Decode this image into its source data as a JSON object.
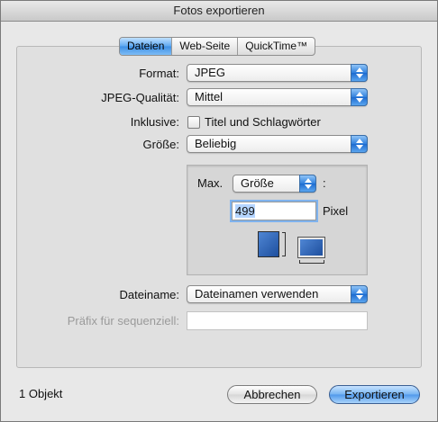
{
  "window": {
    "title": "Fotos exportieren"
  },
  "tabs": [
    {
      "label": "Dateien",
      "active": true
    },
    {
      "label": "Web-Seite",
      "active": false
    },
    {
      "label": "QuickTime™",
      "active": false
    }
  ],
  "form": {
    "format": {
      "label": "Format:",
      "value": "JPEG"
    },
    "quality": {
      "label": "JPEG-Qualität:",
      "value": "Mittel"
    },
    "include": {
      "label": "Inklusive:",
      "checkbox_label": "Titel und Schlagwörter",
      "checked": false
    },
    "size": {
      "label": "Größe:",
      "value": "Beliebig"
    },
    "max": {
      "label": "Max.",
      "dimension": "Größe",
      "colon": ":",
      "value": "499",
      "unit": "Pixel"
    },
    "filename": {
      "label": "Dateiname:",
      "value": "Dateinamen verwenden"
    },
    "prefix": {
      "label": "Präfix für sequenziell:",
      "value": ""
    }
  },
  "footer": {
    "count": "1 Objekt",
    "cancel_label": "Abbrechen",
    "export_label": "Exportieren"
  },
  "colors": {
    "accent": "#3f8fe4",
    "window_bg": "#e8e8e8"
  },
  "icons": [
    "up-down-arrows-icon",
    "portrait-orientation-icon",
    "landscape-orientation-icon"
  ]
}
